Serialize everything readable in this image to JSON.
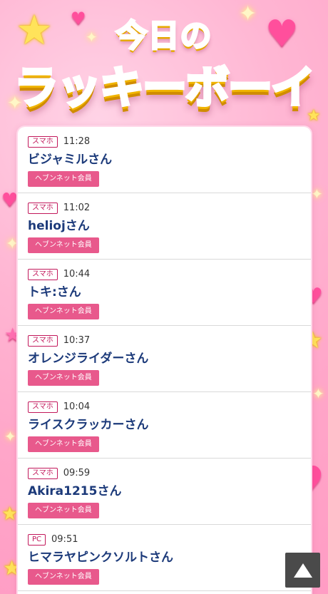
{
  "header": {
    "title_line1": "今日の",
    "title_line2": "ラッキーボーイ"
  },
  "entries": [
    {
      "device": "スマホ",
      "time": "11:28",
      "name": "ビジャミルさん",
      "badge": "ヘブンネット会員"
    },
    {
      "device": "スマホ",
      "time": "11:02",
      "name": "heliojさん",
      "badge": "ヘブンネット会員"
    },
    {
      "device": "スマホ",
      "time": "10:44",
      "name": "トキ:さん",
      "badge": "ヘブンネット会員"
    },
    {
      "device": "スマホ",
      "time": "10:37",
      "name": "オレンジライダーさん",
      "badge": "ヘブンネット会員"
    },
    {
      "device": "スマホ",
      "time": "10:04",
      "name": "ライスクラッカーさん",
      "badge": "ヘブンネット会員"
    },
    {
      "device": "スマホ",
      "time": "09:59",
      "name": "Akira1215さん",
      "badge": "ヘブンネット会員"
    },
    {
      "device": "PC",
      "time": "09:51",
      "name": "ヒマラヤピンクソルトさん",
      "badge": "ヘブンネット会員"
    }
  ],
  "colors": {
    "accent": "#e8598c",
    "device_badge": "#c2185b",
    "name_text": "#1c3a7a",
    "scroll_top_button": "#4a4a4a"
  },
  "icons": {
    "scroll_top": "triangle-up-icon"
  }
}
